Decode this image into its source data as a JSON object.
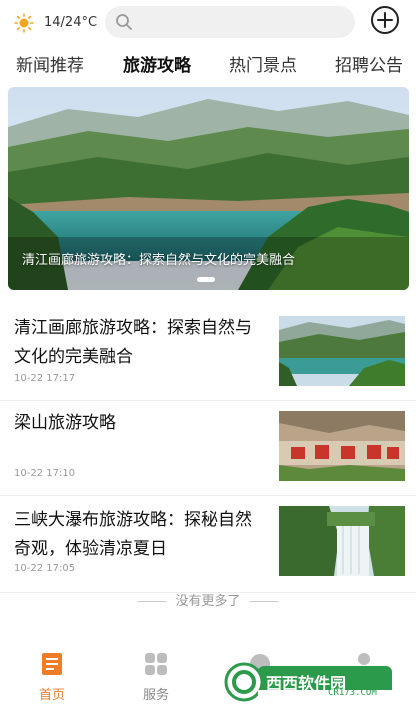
{
  "header": {
    "weather": "14/24°C",
    "search": {
      "value": "",
      "placeholder": ""
    }
  },
  "tabs": [
    {
      "label": "新闻推荐",
      "active": false
    },
    {
      "label": "旅游攻略",
      "active": true
    },
    {
      "label": "热门景点",
      "active": false
    },
    {
      "label": "招聘公告",
      "active": false
    }
  ],
  "banner": {
    "caption": "清江画廊旅游攻略：探索自然与文化的完美融合"
  },
  "news": [
    {
      "title": "清江画廊旅游攻略：探索自然与文化的完美融合",
      "time": "10-22 17:17"
    },
    {
      "title": "梁山旅游攻略",
      "time": "10-22 17:10"
    },
    {
      "title": "三峡大瀑布旅游攻略：探秘自然奇观，体验清凉夏日",
      "time": "10-22 17:05"
    }
  ],
  "list_end": "没有更多了",
  "bottom_nav": [
    {
      "label": "首页",
      "icon": "home-icon",
      "active": true
    },
    {
      "label": "服务",
      "icon": "grid-icon",
      "active": false
    }
  ],
  "watermark": {
    "text": "西西软件园",
    "sub": "CR173.COM"
  },
  "colors": {
    "accent": "#f07c28",
    "weather_sun": "#f5a623",
    "watermark_green": "#2b9a4a"
  }
}
